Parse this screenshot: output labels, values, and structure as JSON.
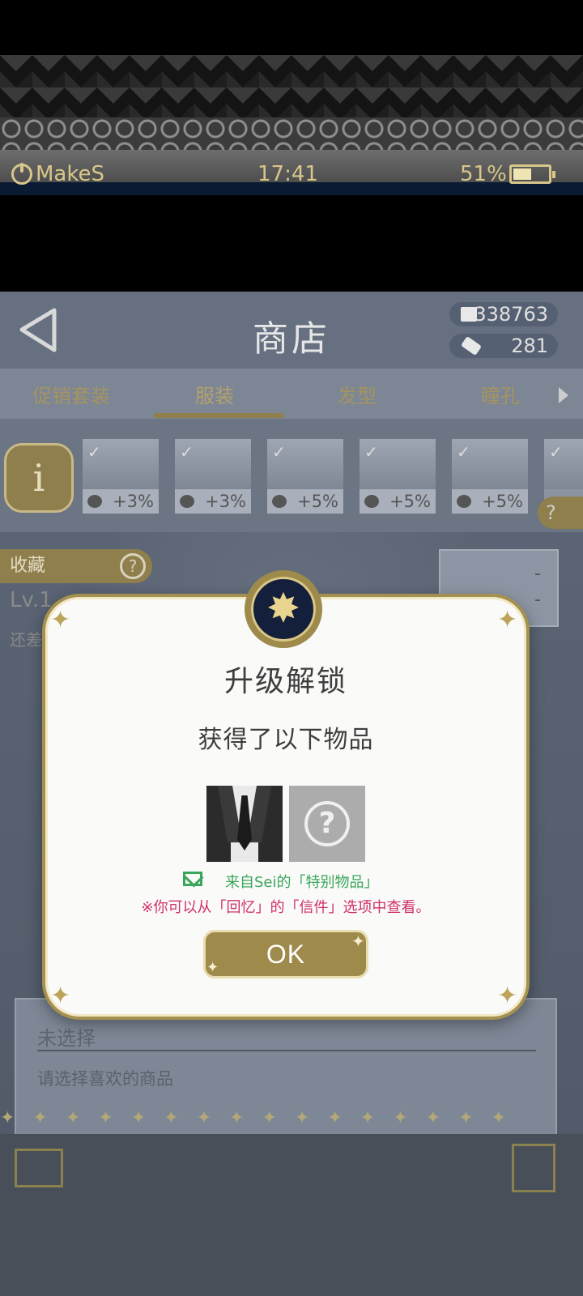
{
  "status_bar": {
    "brand": "MakeS",
    "time": "17:41",
    "battery": "51%"
  },
  "header": {
    "title": "商店",
    "currency_notes": "338763",
    "currency_tags": "281"
  },
  "tabs": [
    "促销套装",
    "服装",
    "发型",
    "瞳孔"
  ],
  "active_tab": "服装",
  "outfits": [
    {
      "stat_icon": "heart-icon",
      "bonus": "+3%"
    },
    {
      "stat_icon": "info-icon",
      "bonus": "+3%"
    },
    {
      "stat_icon": "note-icon",
      "bonus": "+5%"
    },
    {
      "stat_icon": "heart-icon",
      "bonus": "+5%"
    },
    {
      "stat_icon": "info-icon",
      "bonus": "+5%"
    }
  ],
  "side": {
    "collect_label": "收藏",
    "level_label": "Lv.1",
    "remain_label": "还差",
    "stat_values": [
      "-",
      "-"
    ]
  },
  "selection": {
    "title": "未选择",
    "hint": "请选择喜欢的商品"
  },
  "modal": {
    "title": "升级解锁",
    "subtitle": "获得了以下物品",
    "from_text": "来自Sei的「特别物品」",
    "note": "※你可以从「回忆」的「信件」选项中查看。",
    "ok_label": "OK",
    "items": [
      "suit-item",
      "unknown-item"
    ]
  },
  "colors": {
    "gold": "#9e8a4b",
    "green": "#3aa65c",
    "pink": "#d0306a"
  }
}
